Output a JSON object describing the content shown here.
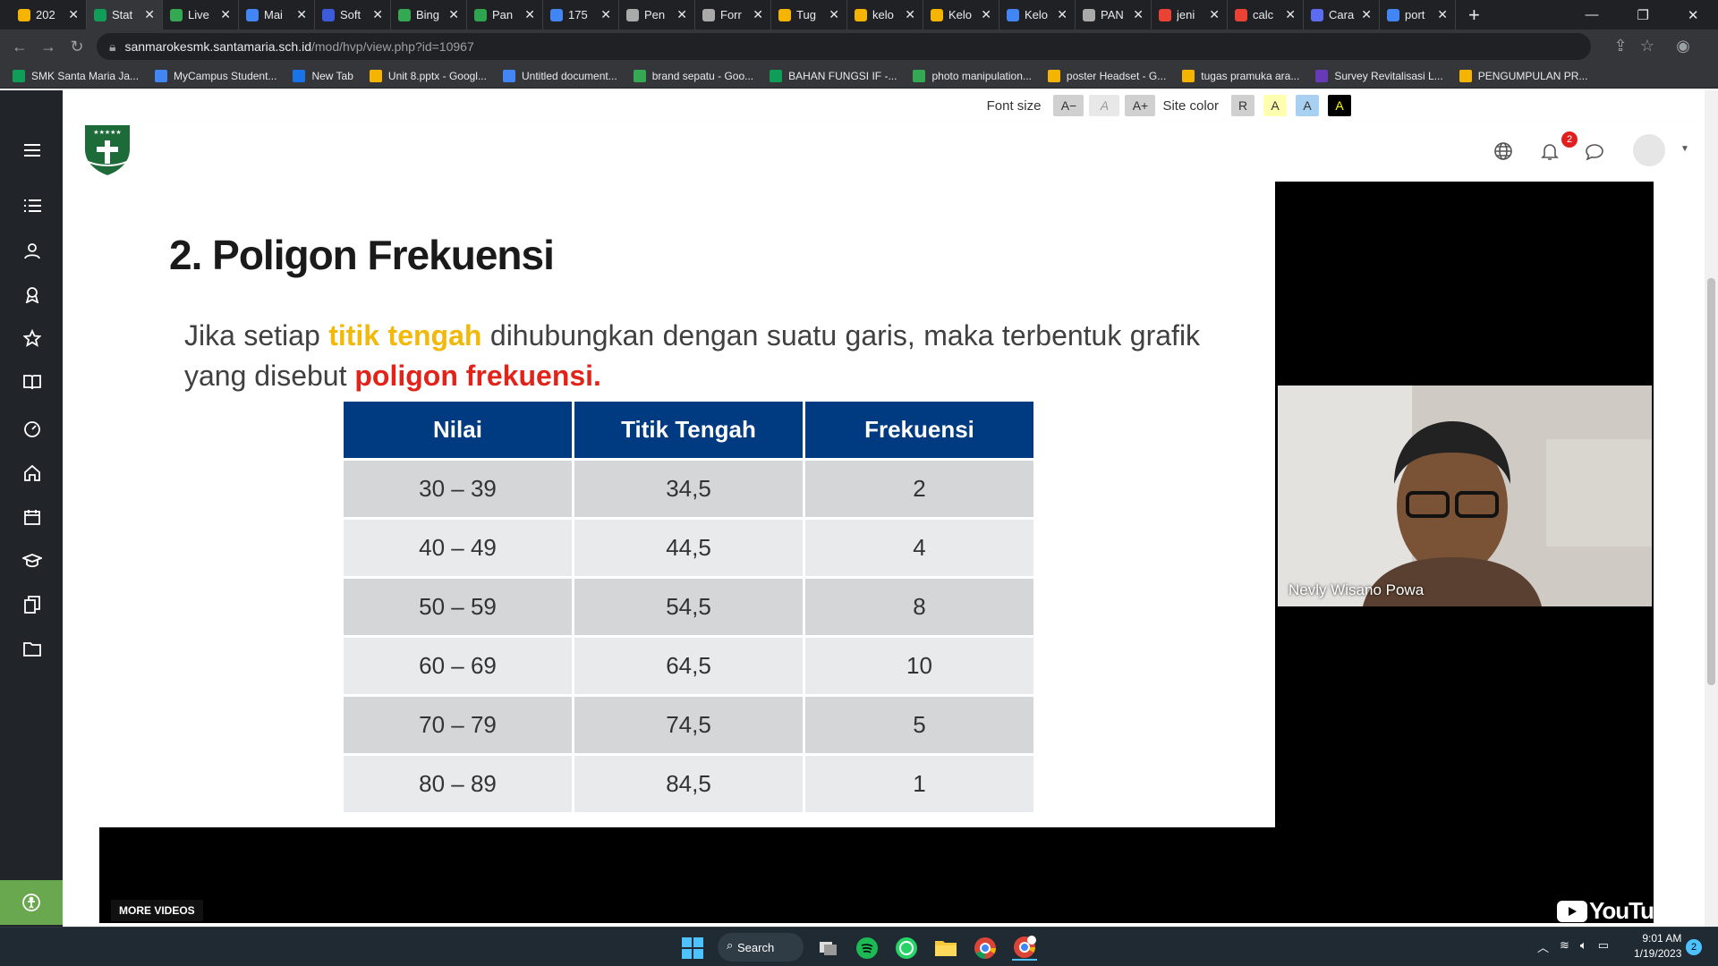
{
  "browser": {
    "tabs": [
      "202",
      "Stat",
      "Live",
      "Mai",
      "Soft",
      "Bing",
      "Pan",
      "175",
      "Pen",
      "Forr",
      "Tug",
      "kelo",
      "Kelo",
      "Kelo",
      "PAN",
      "jeni",
      "calc",
      "Cara",
      "port"
    ],
    "url_host": "sanmarokesmk.santamaria.sch.id",
    "url_path": "/mod/hvp/view.php?id=10967",
    "bookmarks": [
      "SMK Santa Maria Ja...",
      "MyCampus Student...",
      "New Tab",
      "Unit 8.pptx - Googl...",
      "Untitled document...",
      "brand sepatu - Goo...",
      "BAHAN FUNGSI IF -...",
      "photo manipulation...",
      "poster Headset - G...",
      "tugas pramuka ara...",
      "Survey Revitalisasi L...",
      "PENGUMPULAN PR..."
    ]
  },
  "accessibility": {
    "font_size_label": "Font size",
    "font_buttons": [
      "A−",
      "A",
      "A+"
    ],
    "site_color_label": "Site color",
    "color_buttons": [
      "R",
      "A",
      "A",
      "A"
    ]
  },
  "header": {
    "notification_count": "2"
  },
  "slide": {
    "title": "2. Poligon Frekuensi",
    "text_1": "Jika setiap",
    "highlight_1": "titik tengah",
    "text_2": "dihubungkan dengan suatu garis, maka terbentuk grafik yang disebut",
    "highlight_2": "poligon frekuensi.",
    "table": {
      "headers": [
        "Nilai",
        "Titik Tengah",
        "Frekuensi"
      ],
      "rows": [
        [
          "30 – 39",
          "34,5",
          "2"
        ],
        [
          "40 – 49",
          "44,5",
          "4"
        ],
        [
          "50 – 59",
          "54,5",
          "8"
        ],
        [
          "60 – 69",
          "64,5",
          "10"
        ],
        [
          "70 – 79",
          "74,5",
          "5"
        ],
        [
          "80 – 89",
          "84,5",
          "1"
        ]
      ]
    }
  },
  "video": {
    "presenter_name": "Nevly Wisano Powa",
    "more_videos": "MORE VIDEOS",
    "youtube_label": "YouTube"
  },
  "taskbar": {
    "search_label": "Search",
    "time": "9:01 AM",
    "date": "1/19/2023",
    "notification_count": "2"
  },
  "colors": {
    "table_header": "#003a80",
    "highlight_yellow": "#f2b90a",
    "highlight_red": "#e2231a",
    "sidebar": "#212529"
  }
}
